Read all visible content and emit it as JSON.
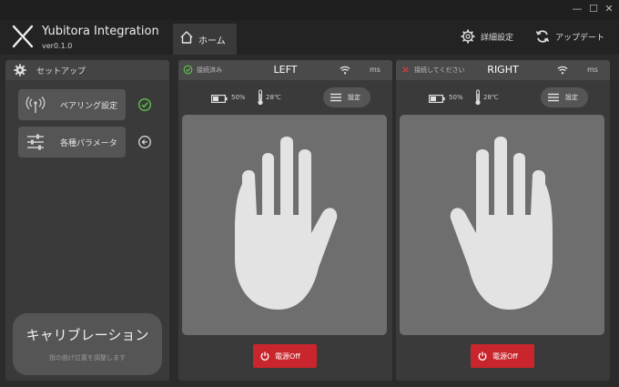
{
  "window": {
    "minimize": "—",
    "maximize": "☐",
    "close": "✕"
  },
  "app": {
    "title": "Yubitora Integration",
    "version": "ver0.1.0"
  },
  "nav": {
    "home_tab": "ホーム",
    "advanced_settings": "詳細設定",
    "update": "アップデート"
  },
  "sidebar": {
    "title": "セットアップ",
    "pairing_label": "ペアリング設定",
    "pairing_status": "complete",
    "params_label": "各種パラメータ",
    "calibration_title": "キャリブレーション",
    "calibration_subtitle": "指の曲げ位置を調整します"
  },
  "panels": {
    "left": {
      "connection": "接続済み",
      "connected": true,
      "name": "LEFT",
      "ms": "ms",
      "battery": "50%",
      "battery_level": 0.5,
      "temperature": "28℃",
      "settings_label": "設定",
      "power_label": "電源Off"
    },
    "right": {
      "connection": "接続してください",
      "connected": false,
      "name": "RIGHT",
      "ms": "ms",
      "battery": "50%",
      "battery_level": 0.5,
      "temperature": "28℃",
      "settings_label": "設定",
      "power_label": "電源Off"
    }
  },
  "colors": {
    "background": "#2b2b2b",
    "panel": "#3a3a3a",
    "button": "#555555",
    "hand_area": "#6e6e6e",
    "hand": "#e3e3e3",
    "power": "#c8262c",
    "ok_green": "#5fbf4a",
    "error_red": "#d04040"
  }
}
